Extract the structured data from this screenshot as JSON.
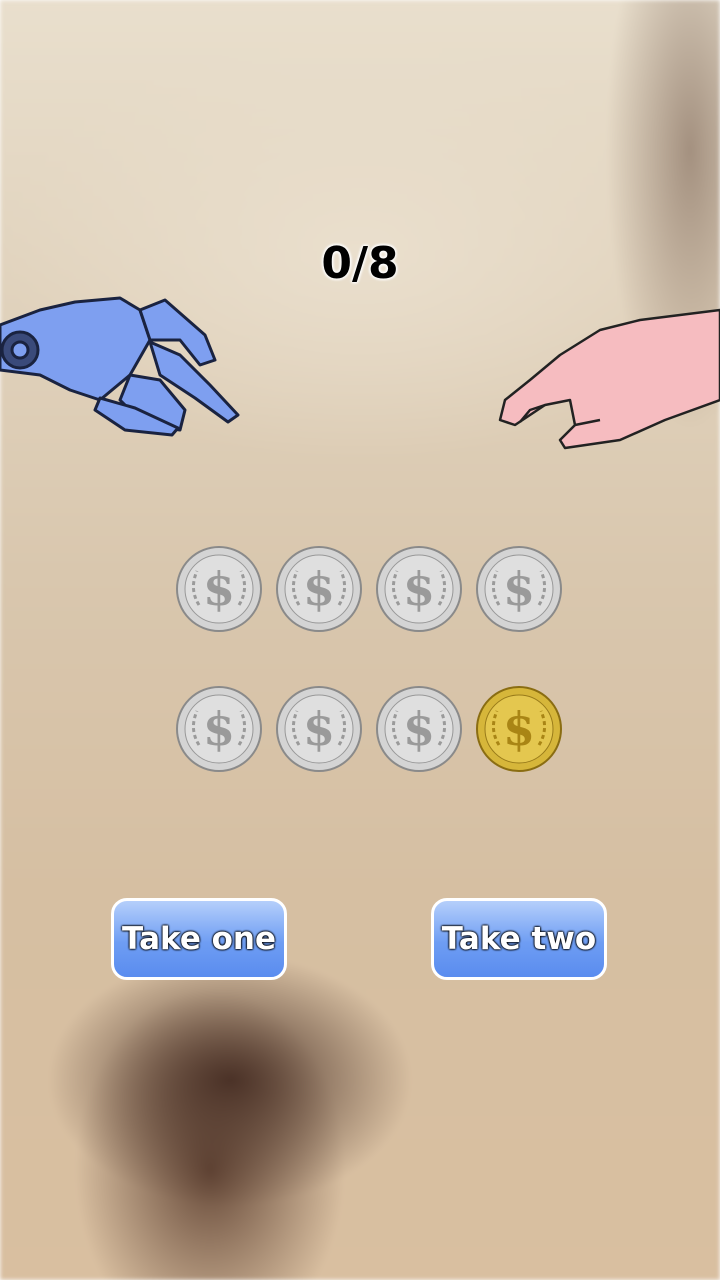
{
  "score": {
    "text": "0/8"
  },
  "coins": [
    {
      "kind": "silver"
    },
    {
      "kind": "silver"
    },
    {
      "kind": "silver"
    },
    {
      "kind": "silver"
    },
    {
      "kind": "silver"
    },
    {
      "kind": "silver"
    },
    {
      "kind": "silver"
    },
    {
      "kind": "gold"
    }
  ],
  "coin_symbol": "$",
  "buttons": {
    "take_one": "Take one",
    "take_two": "Take two"
  },
  "colors": {
    "button_top": "#b5cffb",
    "button_bottom": "#5a8cef",
    "robot_hand": "#7e9ff0",
    "human_hand": "#f6bcc0",
    "silver": "#d4d4d4",
    "gold": "#d6b63a"
  }
}
